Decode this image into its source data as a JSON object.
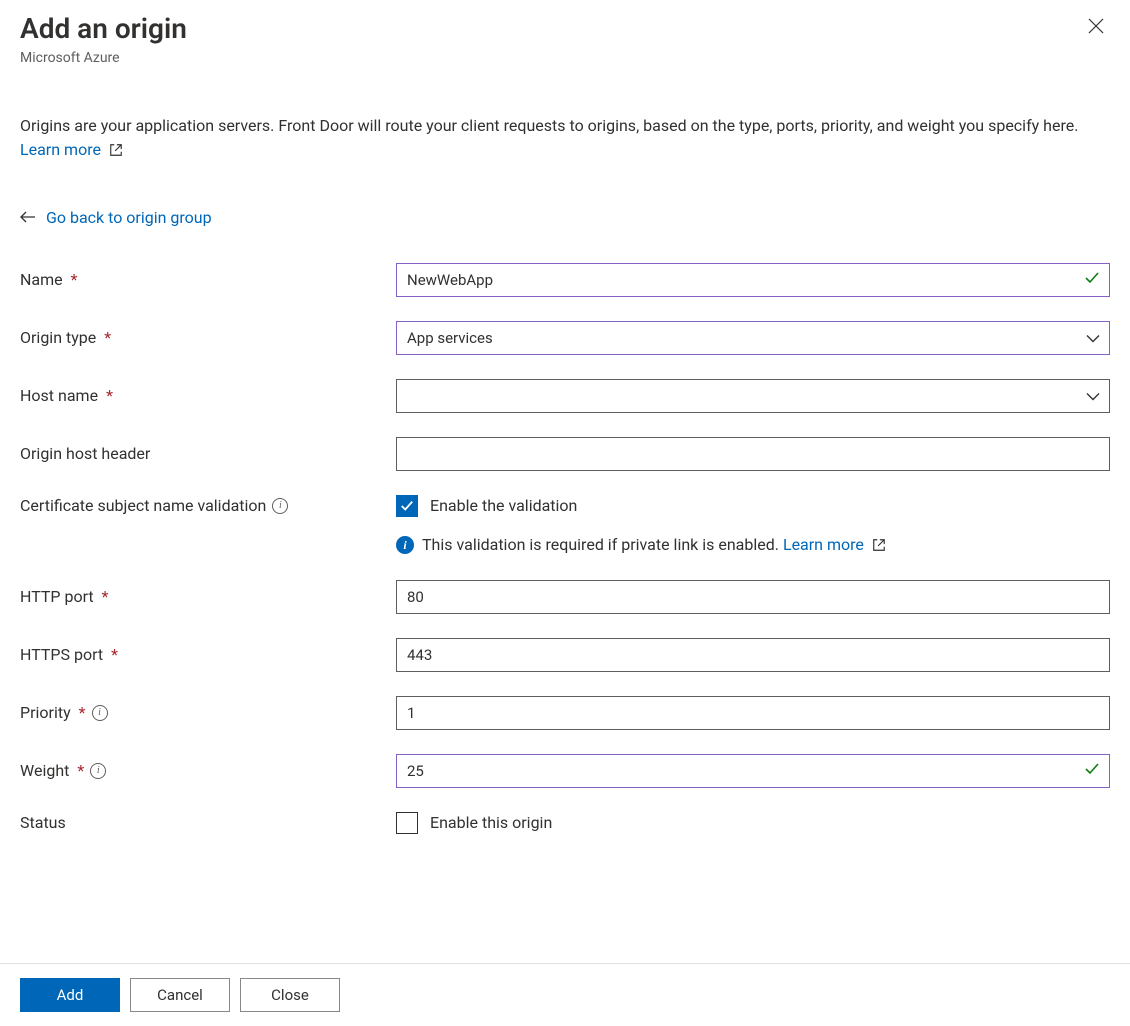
{
  "header": {
    "title": "Add an origin",
    "subtitle": "Microsoft Azure"
  },
  "description": {
    "text": "Origins are your application servers. Front Door will route your client requests to origins, based on the type, ports, priority, and weight you specify here. ",
    "learn_more": "Learn more"
  },
  "back_link": "Go back to origin group",
  "form": {
    "name": {
      "label": "Name",
      "value": "NewWebApp"
    },
    "origin_type": {
      "label": "Origin type",
      "value": "App services"
    },
    "host_name": {
      "label": "Host name",
      "value": ""
    },
    "origin_host_header": {
      "label": "Origin host header",
      "value": ""
    },
    "cert_validation": {
      "label": "Certificate subject name validation",
      "checkbox_label": "Enable the validation",
      "checked": true,
      "info_msg": "This validation is required if private link is enabled. ",
      "info_learn_more": "Learn more"
    },
    "http_port": {
      "label": "HTTP port",
      "value": "80"
    },
    "https_port": {
      "label": "HTTPS port",
      "value": "443"
    },
    "priority": {
      "label": "Priority",
      "value": "1"
    },
    "weight": {
      "label": "Weight",
      "value": "25"
    },
    "status": {
      "label": "Status",
      "checkbox_label": "Enable this origin",
      "checked": false
    }
  },
  "footer": {
    "add": "Add",
    "cancel": "Cancel",
    "close": "Close"
  }
}
